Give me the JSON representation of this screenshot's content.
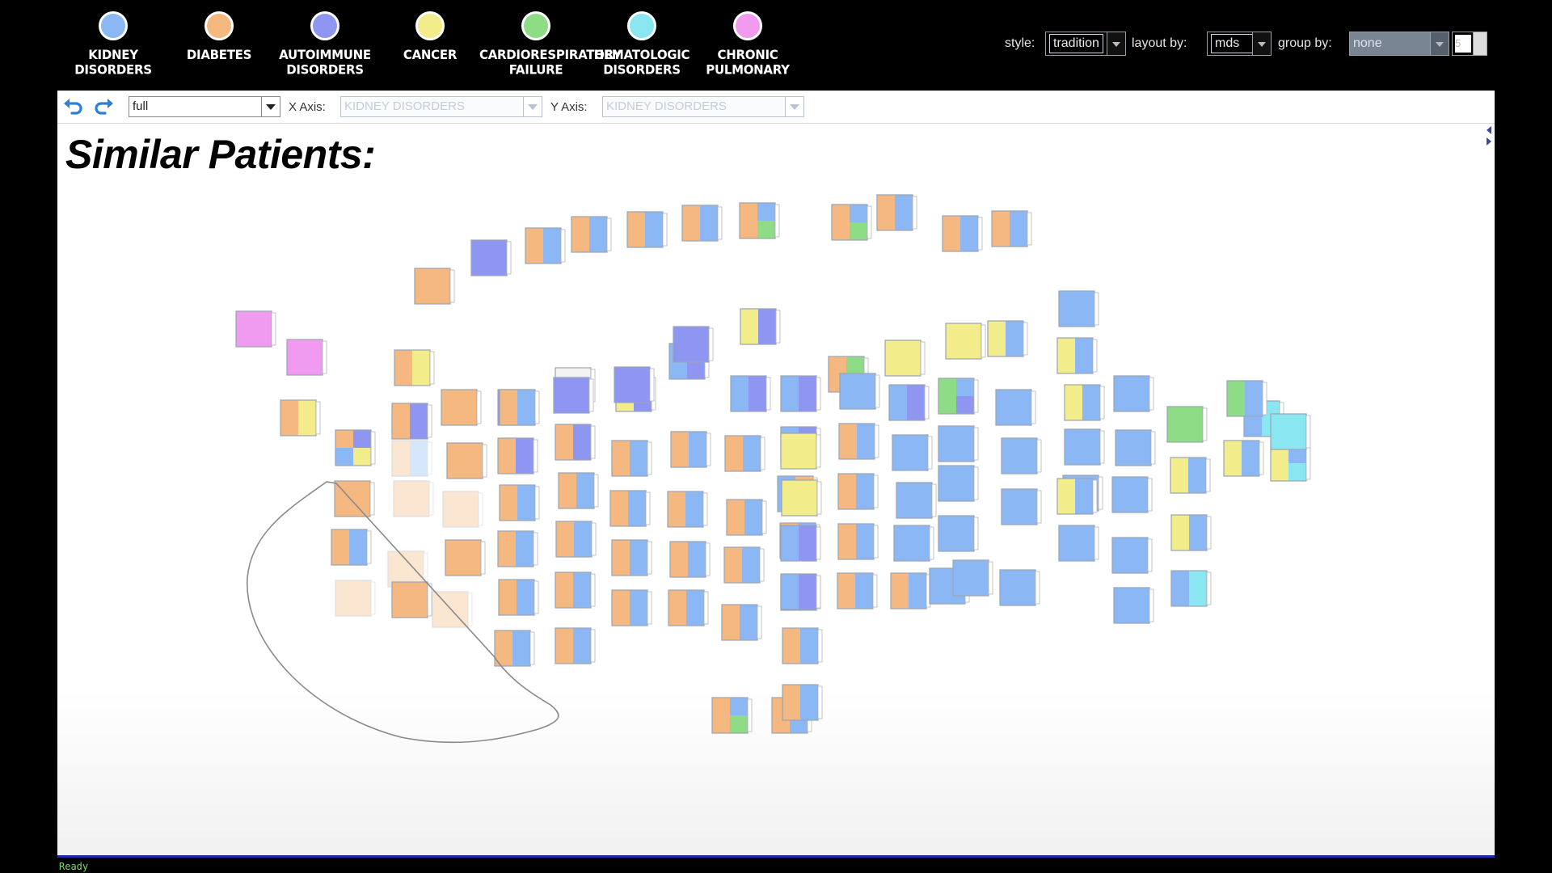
{
  "legend": [
    {
      "label": "KIDNEY\nDISORDERS",
      "color": "#8bb8f5"
    },
    {
      "label": "DIABETES",
      "color": "#f4b880"
    },
    {
      "label": "AUTOIMMUNE\nDISORDERS",
      "color": "#8f96f2"
    },
    {
      "label": "CANCER",
      "color": "#f2ec8a"
    },
    {
      "label": "CARDIORESPIRATORY\nFAILURE",
      "color": "#8edc86"
    },
    {
      "label": "HEMATOLOGIC\nDISORDERS",
      "color": "#8ae6f0"
    },
    {
      "label": "CHRONIC\nPULMONARY",
      "color": "#f09bf0"
    }
  ],
  "controls": {
    "style_label": "style:",
    "style_value": "tradition",
    "layout_label": "layout by:",
    "layout_value": "mds",
    "group_label": "group by:",
    "group_value": "none",
    "spin_value": "5"
  },
  "toolbar": {
    "view_value": "full",
    "x_axis_label": "X Axis:",
    "x_axis_value": "KIDNEY DISORDERS",
    "y_axis_label": "Y Axis:",
    "y_axis_value": "KIDNEY DISORDERS"
  },
  "title": "Similar Patients:",
  "status": "Ready",
  "colors": {
    "kidney": "#8bb8f5",
    "diabetes": "#f4b880",
    "autoimmune": "#8f96f2",
    "cancer": "#f2ec8a",
    "cardio": "#8edc86",
    "hemato": "#8ae6f0",
    "pulmonary": "#f09bf0",
    "empty": "#f3f3f3"
  },
  "patients": [
    {
      "p": "P"
    },
    {
      "p": "P"
    },
    {
      "p": "DC"
    },
    {
      "p": "DAKC"
    },
    {
      "p": "D"
    },
    {
      "p": "DK"
    },
    {
      "p": "DC"
    },
    {
      "p": "D"
    },
    {
      "p": "D"
    },
    {
      "p": "D"
    },
    {
      "p": "D"
    },
    {
      "p": "DA"
    },
    {
      "p": "DK"
    },
    {
      "p": "D"
    },
    {
      "p": "D"
    },
    {
      "p": "D"
    },
    {
      "p": "D"
    },
    {
      "p": "D"
    },
    {
      "p": "D"
    },
    {
      "p": "A"
    },
    {
      "p": "A"
    },
    {
      "p": "DA"
    },
    {
      "p": "DK"
    },
    {
      "p": "DK"
    },
    {
      "p": "DK"
    },
    {
      "p": "DK"
    },
    {
      "p": "DK"
    },
    {
      "p": "DK"
    },
    {
      "p": "E"
    },
    {
      "p": "DA"
    },
    {
      "p": "DK"
    },
    {
      "p": "DK"
    },
    {
      "p": "DK"
    },
    {
      "p": "DK"
    },
    {
      "p": "DK"
    },
    {
      "p": "A"
    },
    {
      "p": "DKCA"
    },
    {
      "p": "DK"
    },
    {
      "p": "DK"
    },
    {
      "p": "DK"
    },
    {
      "p": "DK"
    },
    {
      "p": "DK"
    },
    {
      "p": "A"
    },
    {
      "p": "KA"
    },
    {
      "p": "DK"
    },
    {
      "p": "DK"
    },
    {
      "p": "DK"
    },
    {
      "p": "DK"
    },
    {
      "p": "DK"
    },
    {
      "p": "A"
    },
    {
      "p": "KA"
    },
    {
      "p": "DK"
    },
    {
      "p": "DK"
    },
    {
      "p": "DK"
    },
    {
      "p": "DK"
    },
    {
      "p": "DKR"
    },
    {
      "p": "DKR"
    },
    {
      "p": "CA"
    },
    {
      "p": "KA"
    },
    {
      "p": "KA"
    },
    {
      "p": "KD"
    },
    {
      "p": "DK"
    },
    {
      "p": "DK"
    },
    {
      "p": "DK"
    },
    {
      "p": "DK"
    },
    {
      "p": "DK"
    },
    {
      "p": "DKR"
    },
    {
      "p": "DR"
    },
    {
      "p": "C"
    },
    {
      "p": "C"
    },
    {
      "p": "KA"
    },
    {
      "p": "KA"
    },
    {
      "p": "K"
    },
    {
      "p": "DK"
    },
    {
      "p": "DK"
    },
    {
      "p": "DK"
    },
    {
      "p": "DK"
    },
    {
      "p": "DK"
    },
    {
      "p": "C"
    },
    {
      "p": "KA"
    },
    {
      "p": "K"
    },
    {
      "p": "K"
    },
    {
      "p": "K"
    },
    {
      "p": "DK"
    },
    {
      "p": "DK"
    },
    {
      "p": "C"
    },
    {
      "p": "RKA"
    },
    {
      "p": "K"
    },
    {
      "p": "K"
    },
    {
      "p": "K"
    },
    {
      "p": "K"
    },
    {
      "p": "K"
    },
    {
      "p": "DK"
    },
    {
      "p": "CK"
    },
    {
      "p": "K"
    },
    {
      "p": "K"
    },
    {
      "p": "K"
    },
    {
      "p": "K"
    },
    {
      "p": "K"
    },
    {
      "p": "CK"
    },
    {
      "p": "CK"
    },
    {
      "p": "K"
    },
    {
      "p": "K"
    },
    {
      "p": "K"
    },
    {
      "p": "K"
    },
    {
      "p": "CK"
    },
    {
      "p": "K"
    },
    {
      "p": "K"
    },
    {
      "p": "K"
    },
    {
      "p": "K"
    },
    {
      "p": "CK"
    },
    {
      "p": "CK"
    },
    {
      "p": "KH"
    },
    {
      "p": "KH"
    },
    {
      "p": "RK"
    },
    {
      "p": "R"
    },
    {
      "p": "CK"
    },
    {
      "p": "CKH"
    },
    {
      "p": "H"
    }
  ]
}
